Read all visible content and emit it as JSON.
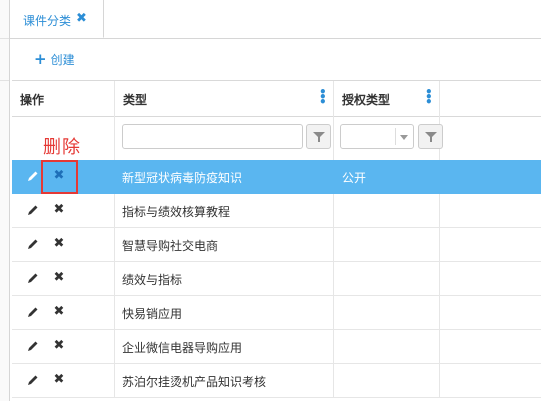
{
  "tabs": [
    {
      "label": "课件分类",
      "close": "✖"
    }
  ],
  "toolbar": {
    "create_label": "创建",
    "create_icon": "plus-icon"
  },
  "grid": {
    "columns": [
      {
        "label": "操作"
      },
      {
        "label": "类型"
      },
      {
        "label": "授权类型"
      }
    ],
    "filters": {
      "type_value": "",
      "auth_value": ""
    },
    "rows": [
      {
        "type": "新型冠状病毒防疫知识",
        "auth": "公开",
        "selected": true
      },
      {
        "type": "指标与绩效核算教程",
        "auth": ""
      },
      {
        "type": "智慧导购社交电商",
        "auth": ""
      },
      {
        "type": "绩效与指标",
        "auth": ""
      },
      {
        "type": "快易销应用",
        "auth": ""
      },
      {
        "type": "企业微信电器导购应用",
        "auth": ""
      },
      {
        "type": "苏泊尔挂烫机产品知识考核",
        "auth": ""
      }
    ]
  },
  "annotation": {
    "label": "删除",
    "color": "#e53935"
  },
  "colors": {
    "accent": "#2c8ed6",
    "selected_row": "#5ab6f0"
  }
}
